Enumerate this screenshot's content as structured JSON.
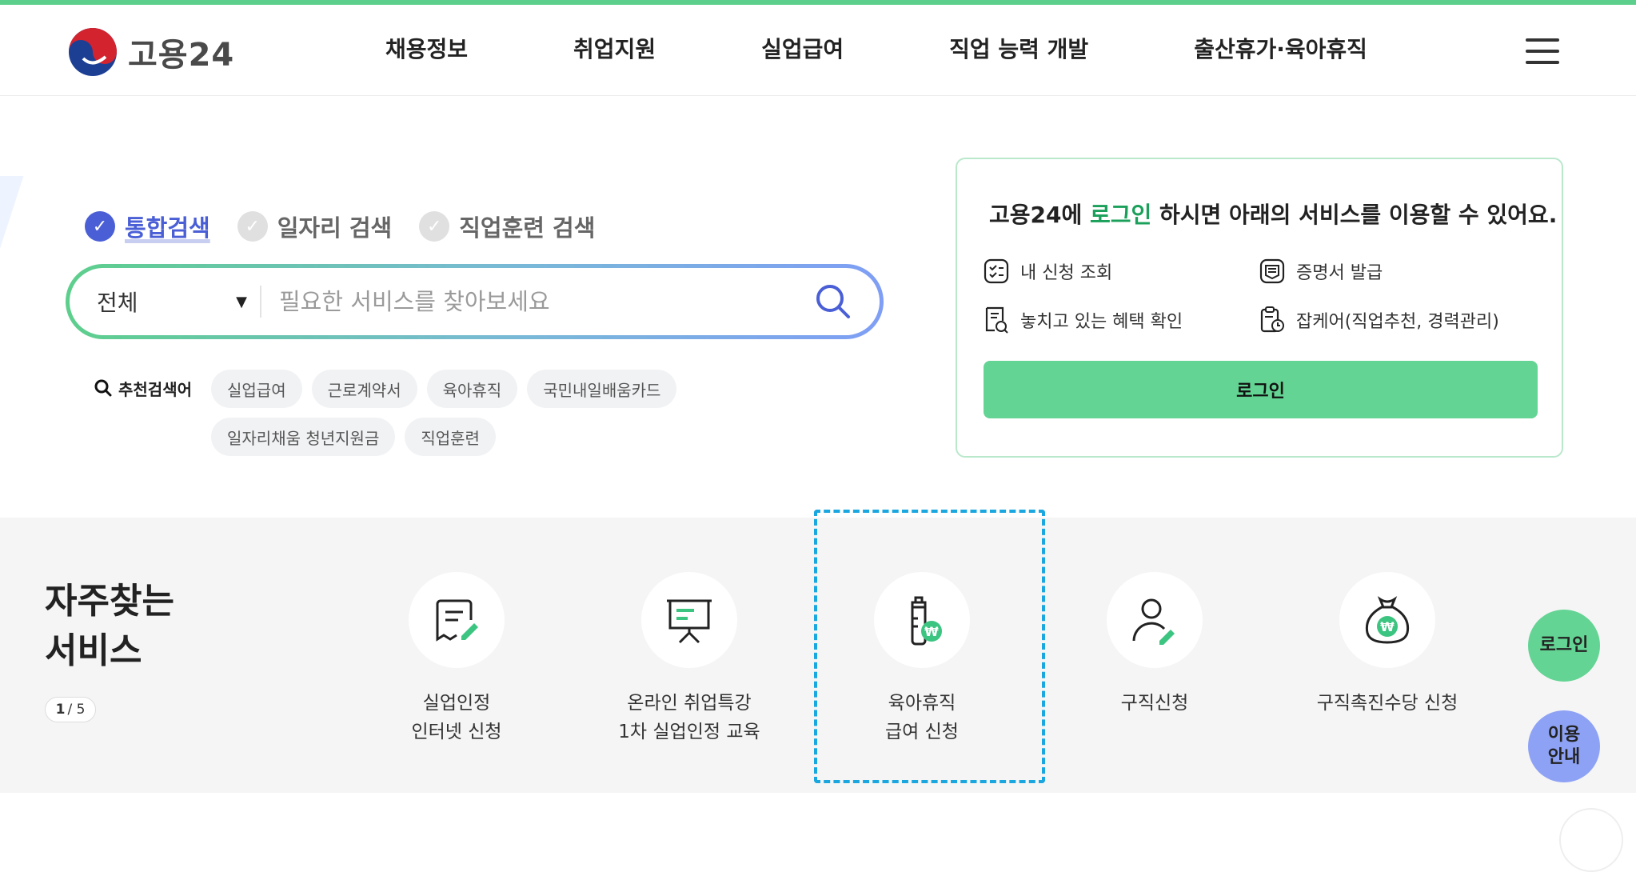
{
  "header": {
    "logo_text": "고용24",
    "nav": [
      "채용정보",
      "취업지원",
      "실업급여",
      "직업 능력 개발",
      "출산휴가·육아휴직"
    ]
  },
  "search": {
    "tabs": [
      {
        "label": "통합검색",
        "active": true
      },
      {
        "label": "일자리 검색",
        "active": false
      },
      {
        "label": "직업훈련 검색",
        "active": false
      }
    ],
    "category": "전체",
    "placeholder": "필요한 서비스를 찾아보세요",
    "recommended_label": "추천검색어",
    "recommended": [
      "실업급여",
      "근로계약서",
      "육아휴직",
      "국민내일배움카드",
      "일자리채움 청년지원금",
      "직업훈련"
    ]
  },
  "login_panel": {
    "title_prefix": "고용24에 ",
    "title_highlight": "로그인",
    "title_suffix": " 하시면 아래의 서비스를 이용할 수 있어요.",
    "services": [
      "내 신청 조회",
      "증명서 발급",
      "놓치고 있는 혜택 확인",
      "잡케어(직업추천, 경력관리)"
    ],
    "login_button": "로그인"
  },
  "favorites": {
    "title": "자주찾는\n서비스",
    "page_current": "1",
    "page_sep": "/ 5",
    "items": [
      {
        "label": "실업인정\n인터넷 신청",
        "icon": "document-edit-icon"
      },
      {
        "label": "온라인 취업특강\n1차 실업인정 교육",
        "icon": "presentation-board-icon"
      },
      {
        "label": "육아휴직\n급여 신청",
        "icon": "baby-bottle-won-icon"
      },
      {
        "label": "구직신청",
        "icon": "person-edit-icon"
      },
      {
        "label": "구직촉진수당 신청",
        "icon": "money-bag-won-icon"
      }
    ]
  },
  "floating": {
    "login": "로그인",
    "guide": "이용\n안내"
  },
  "colors": {
    "brand_green": "#63d493",
    "accent_blue": "#4a5fd6",
    "highlight_border": "#1aa6df"
  }
}
